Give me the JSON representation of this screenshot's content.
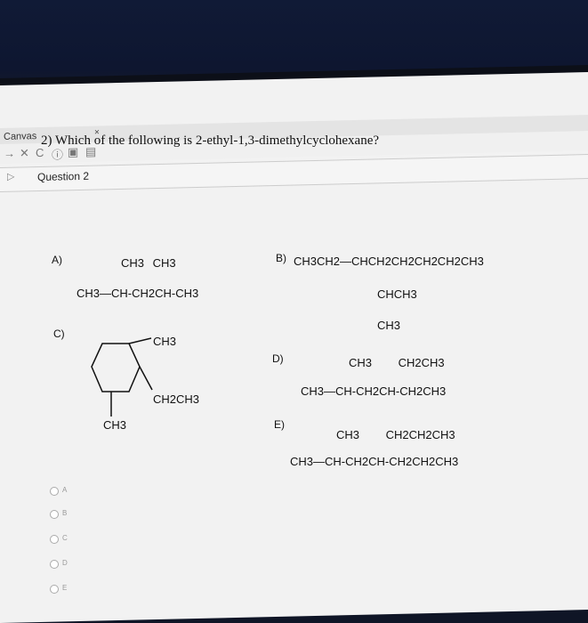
{
  "browser": {
    "tab_title": "Canvas",
    "tab_close": "×"
  },
  "toolbar": {
    "icons": [
      "back-arrow-icon",
      "stop-icon",
      "reload-icon",
      "info-icon",
      "reader-icon",
      "bookmark-icon"
    ]
  },
  "question_header": {
    "title": "Question 2"
  },
  "question": {
    "text": "2) Which of the following is 2-ethyl-1,3-dimethylcyclohexane?"
  },
  "options": {
    "A": {
      "label": "A)",
      "top": "CH3    CH3",
      "main": "CH3—CH-CH2CH-CH3"
    },
    "B": {
      "label": "B)",
      "main": "CH3CH2—CHCH2CH2CH2CH2CH3",
      "branch1": "CHCH3",
      "branch2": "CH3"
    },
    "C": {
      "label": "C)",
      "sub1": "CH3",
      "sub2": "CH2CH3",
      "sub3": "CH3"
    },
    "D": {
      "label": "D)",
      "top": "CH3    CH2CH3",
      "main": "CH3—CH-CH2CH-CH2CH3"
    },
    "E": {
      "label": "E)",
      "top": "CH3    CH2CH2CH3",
      "main": "CH3—CH-CH2CH-CH2CH2CH3"
    }
  },
  "answers": [
    "A",
    "B",
    "C",
    "D",
    "E"
  ]
}
